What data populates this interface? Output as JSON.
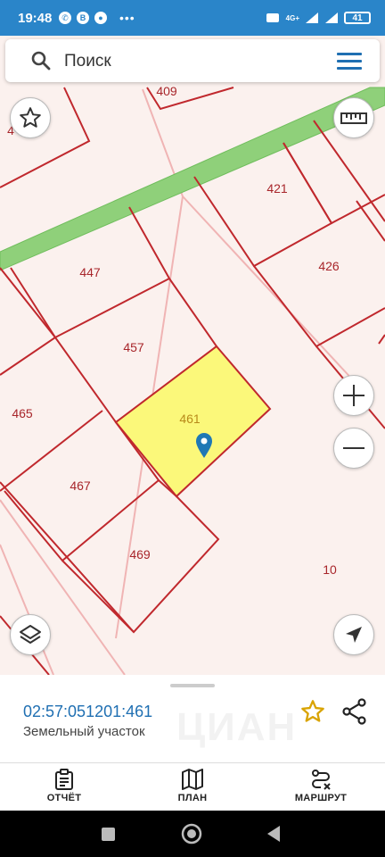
{
  "status_bar": {
    "time": "19:48",
    "notification_icons": [
      "whatsapp-icon",
      "b-icon",
      "chat-icon"
    ],
    "network": "4G+",
    "battery": "41"
  },
  "search": {
    "placeholder": "Поиск"
  },
  "map": {
    "parcels": [
      {
        "label": "409"
      },
      {
        "label": "421"
      },
      {
        "label": "426"
      },
      {
        "label": "447"
      },
      {
        "label": "457"
      },
      {
        "label": "461"
      },
      {
        "label": "465"
      },
      {
        "label": "467"
      },
      {
        "label": "469"
      },
      {
        "label": "10"
      },
      {
        "label": "4"
      }
    ],
    "selected_parcel": "461",
    "colors": {
      "background": "#fbf1ee",
      "boundary": "#c0282d",
      "selection": "#fbf87a",
      "road": "#8fd07a"
    }
  },
  "map_controls": {
    "favorites": "star-icon",
    "ruler": "ruler-icon",
    "zoom_in": "plus-icon",
    "zoom_out": "minus-icon",
    "layers": "layers-icon",
    "my_location": "navigation-arrow-icon"
  },
  "details": {
    "cadastral_number": "02:57:051201:461",
    "object_type": "Земельный участок",
    "watermark": "ЦИАН"
  },
  "bottom_nav": {
    "items": [
      {
        "label": "ОТЧЁТ",
        "icon": "clipboard-icon"
      },
      {
        "label": "ПЛАН",
        "icon": "map-icon"
      },
      {
        "label": "МАРШРУТ",
        "icon": "route-icon"
      }
    ]
  },
  "colors": {
    "status_bar": "#2a85c9",
    "accent_blue": "#1f6fb2",
    "star_gold": "#d9a300"
  }
}
